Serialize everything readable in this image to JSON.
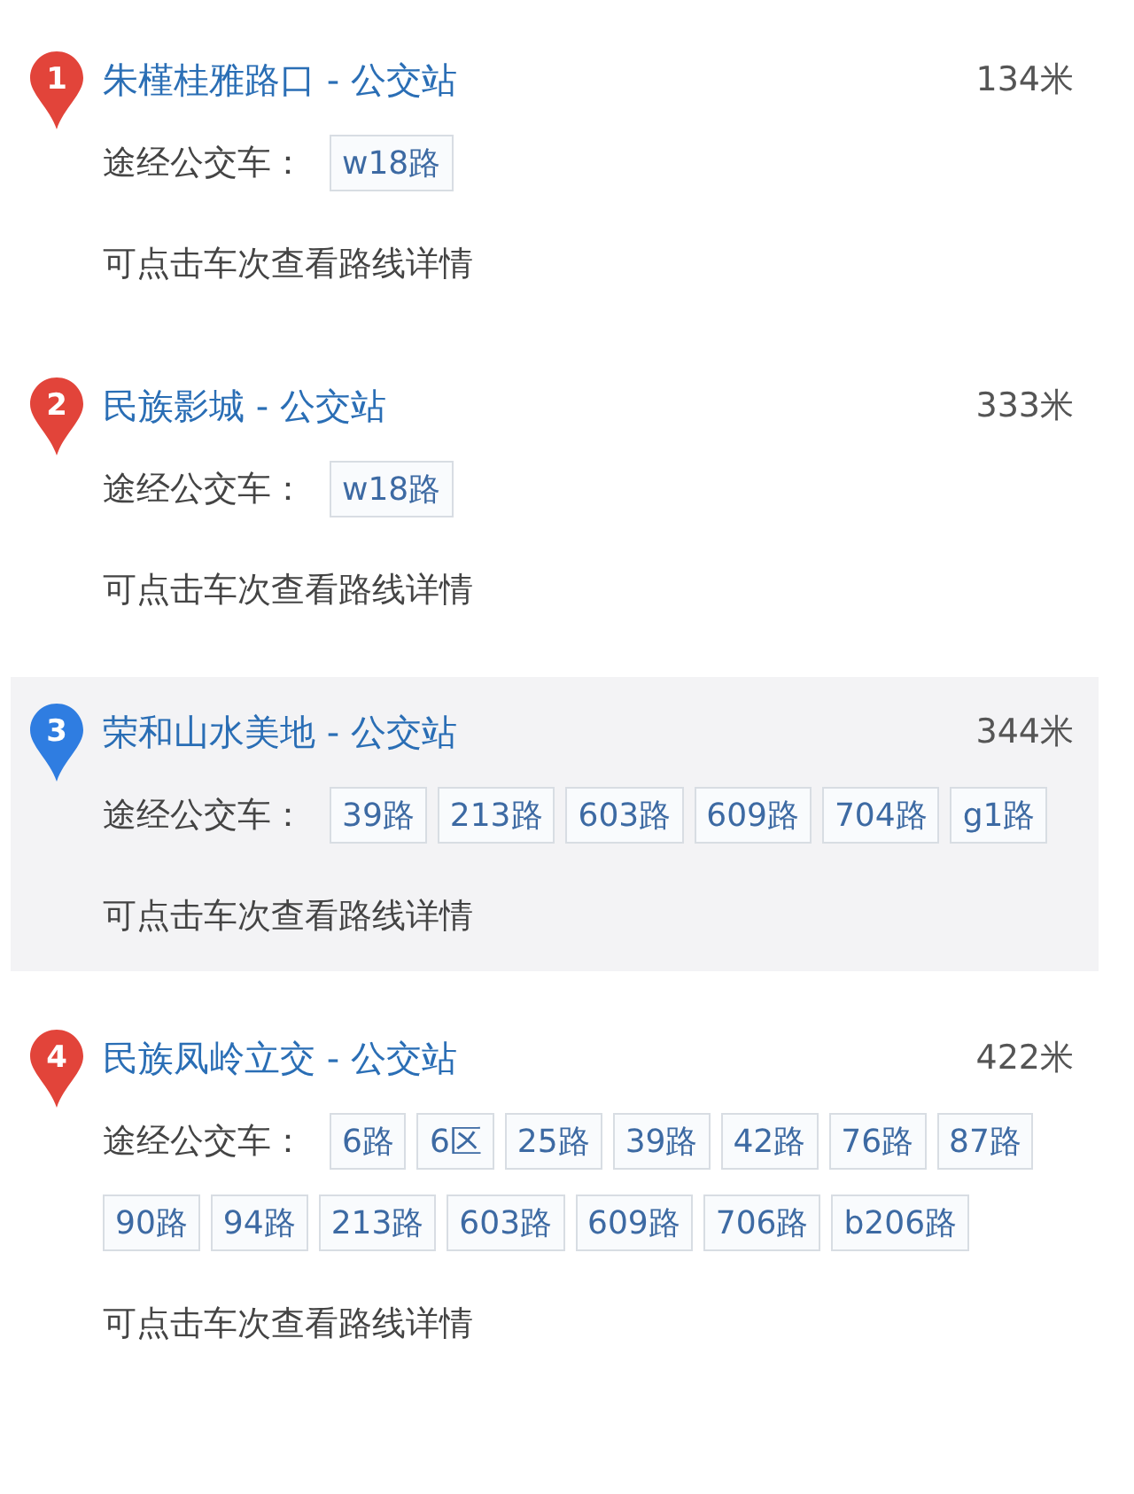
{
  "stations": [
    {
      "number": "1",
      "name": "朱槿桂雅路口 - 公交站",
      "distance": "134米",
      "routes_label": "途经公交车：",
      "routes": [
        "w18路"
      ],
      "hint": "可点击车次查看路线详情",
      "selected": false
    },
    {
      "number": "2",
      "name": "民族影城 - 公交站",
      "distance": "333米",
      "routes_label": "途经公交车：",
      "routes": [
        "w18路"
      ],
      "hint": "可点击车次查看路线详情",
      "selected": false
    },
    {
      "number": "3",
      "name": "荣和山水美地 - 公交站",
      "distance": "344米",
      "routes_label": "途经公交车：",
      "routes": [
        "39路",
        "213路",
        "603路",
        "609路",
        "704路",
        "g1路"
      ],
      "hint": "可点击车次查看路线详情",
      "selected": true
    },
    {
      "number": "4",
      "name": "民族凤岭立交 - 公交站",
      "distance": "422米",
      "routes_label": "途经公交车：",
      "routes": [
        "6路",
        "6区",
        "25路",
        "39路",
        "42路",
        "76路",
        "87路",
        "90路",
        "94路",
        "213路",
        "603路",
        "609路",
        "706路",
        "b206路"
      ],
      "hint": "可点击车次查看路线详情",
      "selected": false
    }
  ]
}
